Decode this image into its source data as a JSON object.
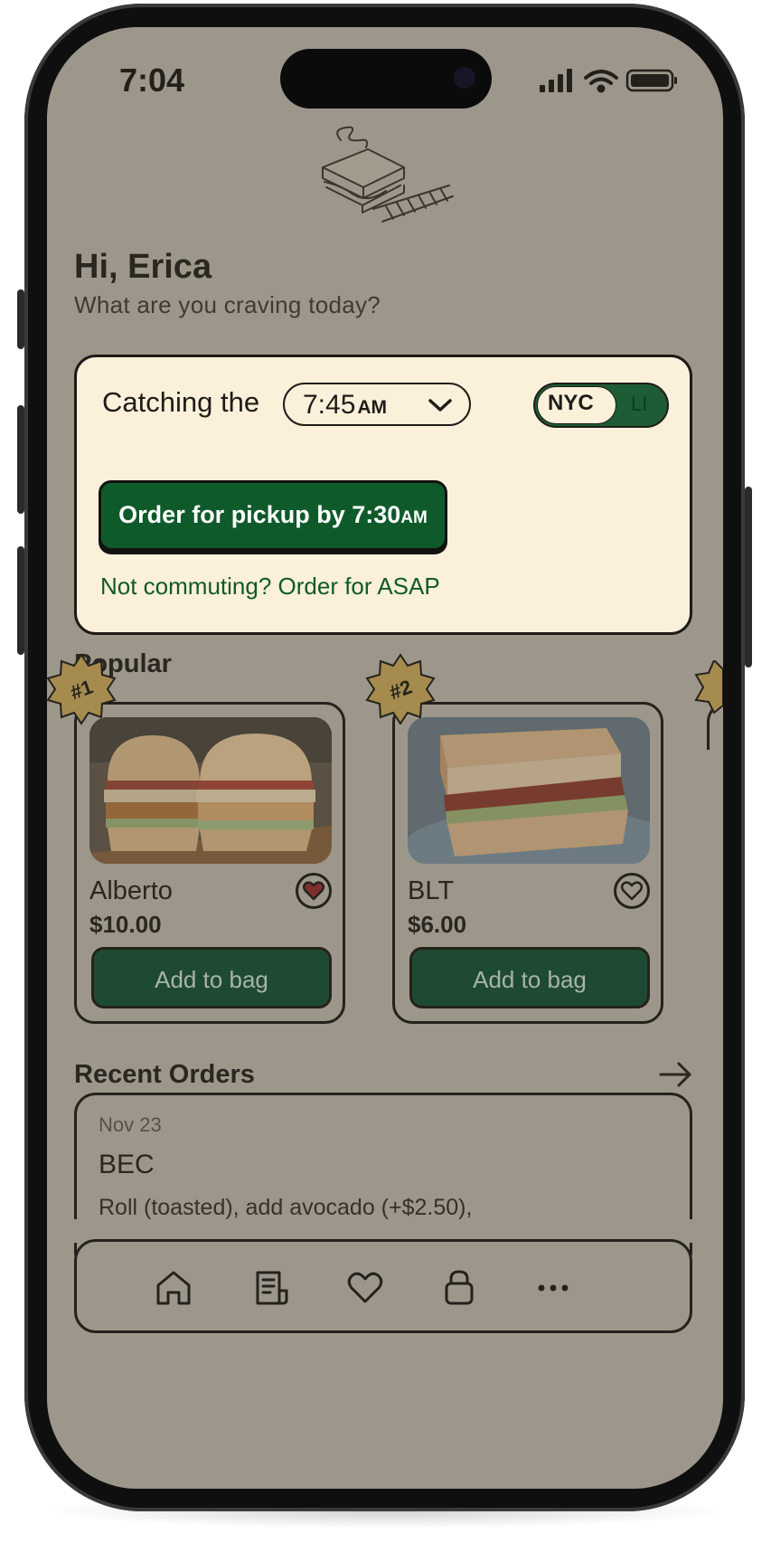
{
  "status_bar": {
    "time": "7:04"
  },
  "greeting": {
    "title": "Hi, Erica",
    "subtitle": "What are you craving today?"
  },
  "commute": {
    "catching_label": "Catching the",
    "train_time": "7:45",
    "train_ampm": "AM",
    "toggle": {
      "selected": "NYC",
      "other": "LI"
    },
    "order_button": {
      "prefix": "Order for pickup by 7:30",
      "ampm": "AM"
    },
    "asap_link": "Not commuting? Order for ASAP"
  },
  "popular": {
    "title": "Popular",
    "items": [
      {
        "rank": "#1",
        "name": "Alberto",
        "price": "$10.00",
        "button": "Add to bag",
        "favorited": true
      },
      {
        "rank": "#2",
        "name": "BLT",
        "price": "$6.00",
        "button": "Add to bag",
        "favorited": false
      }
    ]
  },
  "recent_orders": {
    "title": "Recent Orders",
    "orders": [
      {
        "date": "Nov 23",
        "name": "BEC",
        "details": "Roll (toasted), add avocado (+$2.50),"
      }
    ]
  },
  "bottom_nav": {
    "items": [
      {
        "icon": "home-icon"
      },
      {
        "icon": "receipt-icon"
      },
      {
        "icon": "heart-icon"
      },
      {
        "icon": "bag-icon"
      },
      {
        "icon": "more-icon"
      }
    ]
  },
  "colors": {
    "screen_overlay": "#9d978b",
    "card_bg": "#fbf0da",
    "brand_green": "#0f5a2b",
    "badge_gold": "#a58b4e"
  }
}
